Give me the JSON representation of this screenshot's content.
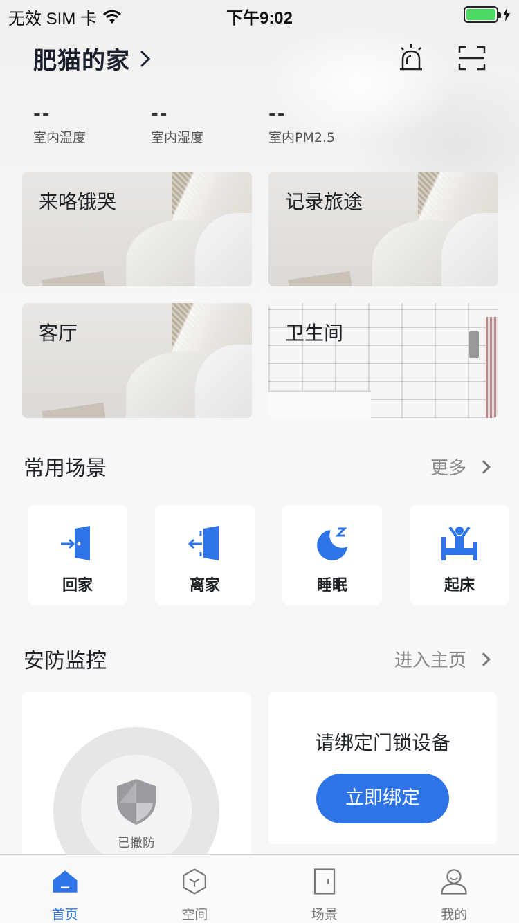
{
  "status_bar": {
    "carrier": "无效 SIM 卡",
    "time": "下午9:02"
  },
  "header": {
    "home_name": "肥猫的家"
  },
  "environment": [
    {
      "value": "--",
      "label": "室内温度"
    },
    {
      "value": "--",
      "label": "室内湿度"
    },
    {
      "value": "--",
      "label": "室内PM2.5"
    }
  ],
  "rooms": [
    {
      "label": "来咯饿哭"
    },
    {
      "label": "记录旅途"
    },
    {
      "label": "客厅"
    },
    {
      "label": "卫生间"
    }
  ],
  "scenes_section": {
    "title": "常用场景",
    "more": "更多"
  },
  "scenes": [
    {
      "label": "回家",
      "icon": "enter-door-icon"
    },
    {
      "label": "离家",
      "icon": "exit-door-icon"
    },
    {
      "label": "睡眠",
      "icon": "moon-sleep-icon"
    },
    {
      "label": "起床",
      "icon": "wake-up-icon"
    }
  ],
  "security_section": {
    "title": "安防监控",
    "more": "进入主页"
  },
  "security": {
    "status": "已撤防"
  },
  "lock": {
    "text": "请绑定门锁设备",
    "button": "立即绑定"
  },
  "tabs": [
    {
      "label": "首页",
      "active": true
    },
    {
      "label": "空间",
      "active": false
    },
    {
      "label": "场景",
      "active": false
    },
    {
      "label": "我的",
      "active": false
    }
  ],
  "colors": {
    "accent": "#2e74e6",
    "battery": "#4cd964"
  }
}
